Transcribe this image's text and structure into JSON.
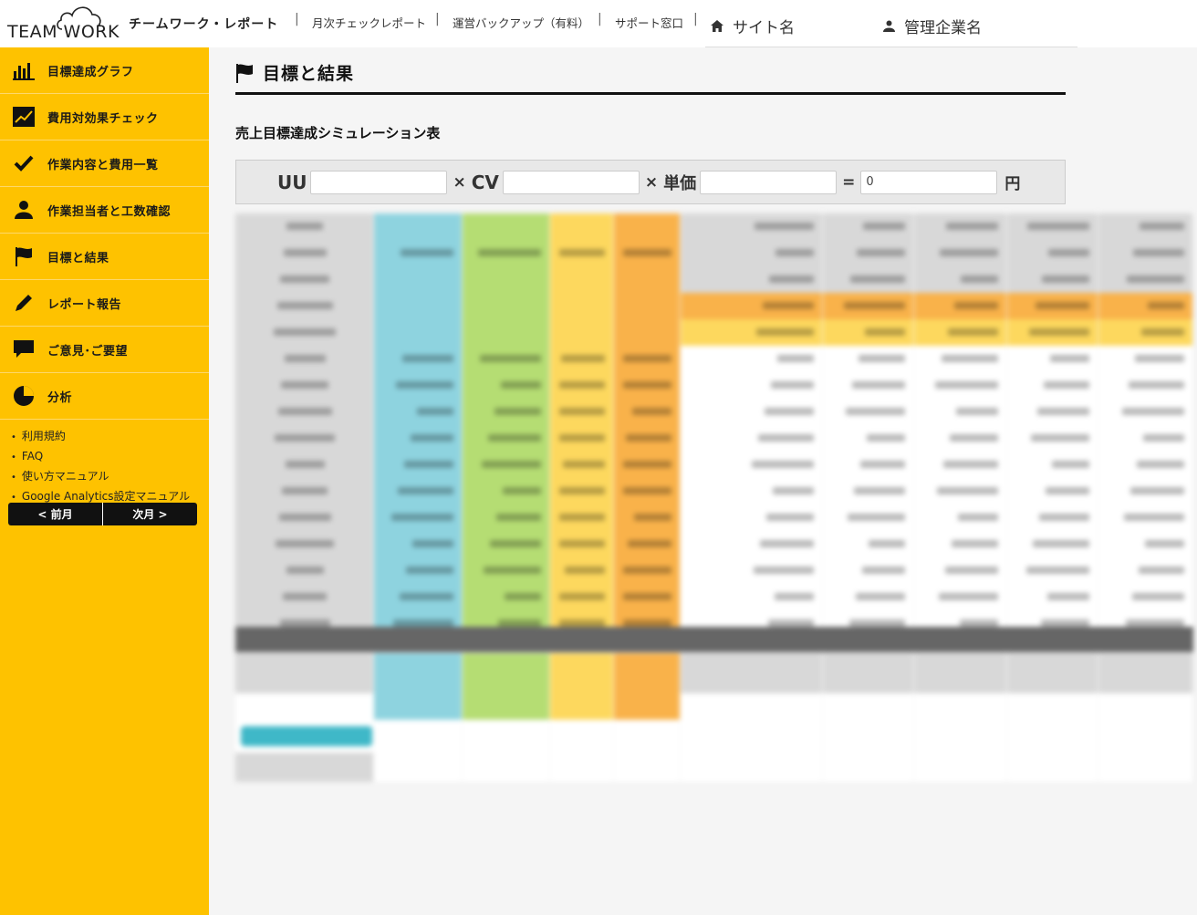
{
  "header": {
    "logo_text": "TEAM WORK",
    "brand": "チームワーク・レポート",
    "nav": [
      "月次チェックレポート",
      "運営バックアップ（有料）",
      "サポート窓口"
    ],
    "site_name": "サイト名",
    "company_name": "管理企業名"
  },
  "sidebar": {
    "items": [
      {
        "label": "目標達成グラフ",
        "icon": "bar-chart-icon"
      },
      {
        "label": "費用対効果チェック",
        "icon": "line-chart-icon"
      },
      {
        "label": "作業内容と費用一覧",
        "icon": "check-icon"
      },
      {
        "label": "作業担当者と工数確認",
        "icon": "user-icon"
      },
      {
        "label": "目標と結果",
        "icon": "flag-icon"
      },
      {
        "label": "レポート報告",
        "icon": "pencil-icon"
      },
      {
        "label": "ご意見･ご要望",
        "icon": "comment-icon"
      },
      {
        "label": "分析",
        "icon": "pie-chart-icon"
      }
    ],
    "links": [
      "利用規約",
      "FAQ",
      "使い方マニュアル",
      "Google Analytics設定マニュアル"
    ],
    "prev": "< 前月",
    "next": "次月 >"
  },
  "main": {
    "title": "目標と結果",
    "section": "売上目標達成シミュレーション表",
    "calc": {
      "uu": "UU",
      "cv": "CV",
      "price": "単価",
      "result": "0",
      "unit": "円",
      "times": "×",
      "equals": "="
    }
  },
  "colors": {
    "sidebar": "#fec200",
    "blue": "#8ed3df",
    "green": "#b5dd73",
    "yellow": "#fdd85e",
    "orange": "#f9b24a",
    "darkbar": "#666666"
  }
}
